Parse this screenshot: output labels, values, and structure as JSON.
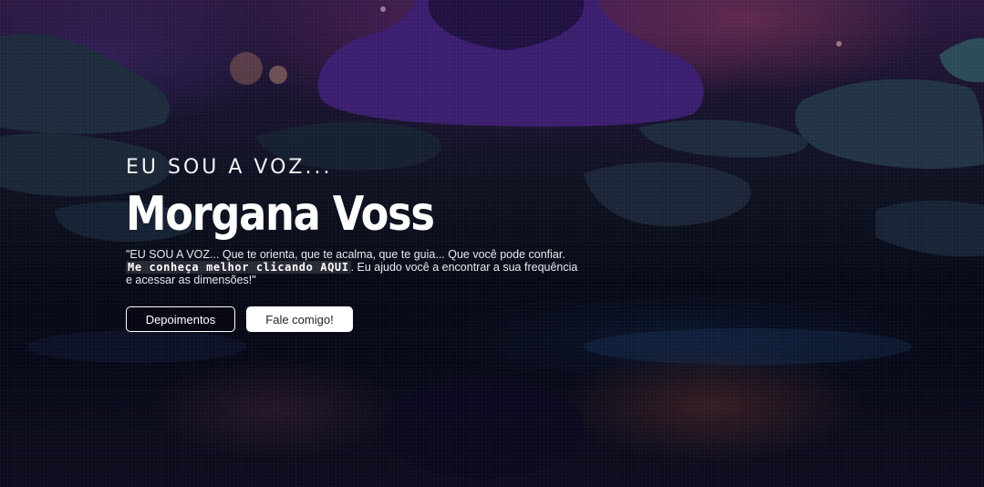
{
  "hero": {
    "kicker": "EU SOU A VOZ...",
    "name": "Morgana Voss",
    "description_line1": "\"EU SOU A VOZ... Que te orienta, que te acalma, que te guia... Que você pode confiar.",
    "description_link": "Me conheça melhor clicando AQUI",
    "description_line2": ". Eu ajudo você a encontrar a sua frequência e acessar as dimensões!\""
  },
  "actions": {
    "testimonials_label": "Depoimentos",
    "contact_label": "Fale comigo!"
  },
  "colors": {
    "text": "#ffffff",
    "background_dark": "#05060f",
    "accent_purple": "#3a1d6e"
  }
}
